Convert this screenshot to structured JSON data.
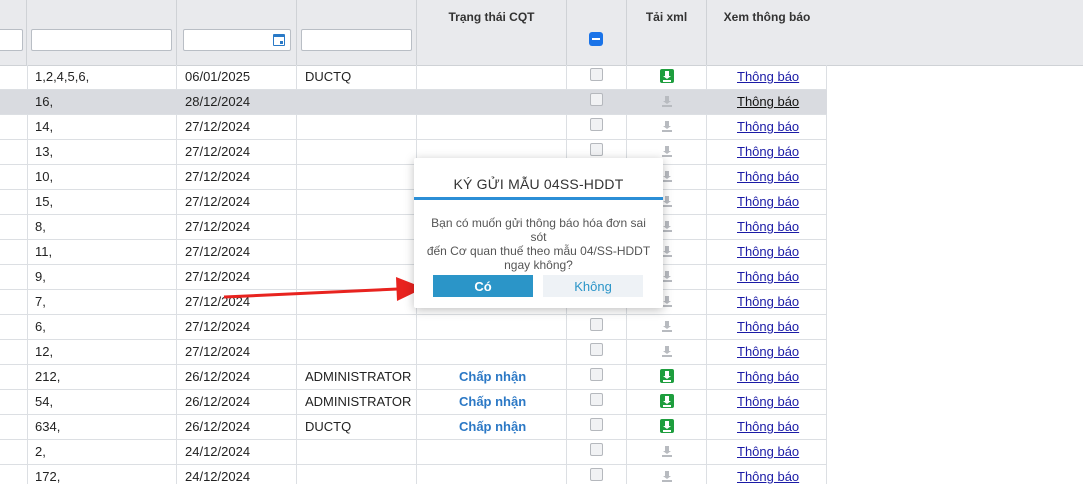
{
  "header": {
    "status_col": "Trạng thái CQT",
    "xml_col": "Tải xml",
    "notice_col": "Xem thông báo"
  },
  "rows": [
    {
      "num": "1,2,4,5,6,",
      "date": "06/01/2025",
      "user": "DUCTQ",
      "status": "",
      "xml": true,
      "link": "Thông báo"
    },
    {
      "num": "16,",
      "date": "28/12/2024",
      "user": "",
      "status": "",
      "xml": false,
      "link": "Thông báo",
      "selected": true
    },
    {
      "num": "14,",
      "date": "27/12/2024",
      "user": "",
      "status": "",
      "xml": false,
      "link": "Thông báo"
    },
    {
      "num": "13,",
      "date": "27/12/2024",
      "user": "",
      "status": "",
      "xml": false,
      "link": "Thông báo"
    },
    {
      "num": "10,",
      "date": "27/12/2024",
      "user": "",
      "status": "",
      "xml": false,
      "link": "Thông báo"
    },
    {
      "num": "15,",
      "date": "27/12/2024",
      "user": "",
      "status": "",
      "xml": false,
      "link": "Thông báo"
    },
    {
      "num": "8,",
      "date": "27/12/2024",
      "user": "",
      "status": "",
      "xml": false,
      "link": "Thông báo"
    },
    {
      "num": "11,",
      "date": "27/12/2024",
      "user": "",
      "status": "",
      "xml": false,
      "link": "Thông báo"
    },
    {
      "num": "9,",
      "date": "27/12/2024",
      "user": "",
      "status": "",
      "xml": false,
      "link": "Thông báo"
    },
    {
      "num": "7,",
      "date": "27/12/2024",
      "user": "",
      "status": "",
      "xml": false,
      "link": "Thông báo"
    },
    {
      "num": "6,",
      "date": "27/12/2024",
      "user": "",
      "status": "",
      "xml": false,
      "link": "Thông báo"
    },
    {
      "num": "12,",
      "date": "27/12/2024",
      "user": "",
      "status": "",
      "xml": false,
      "link": "Thông báo"
    },
    {
      "num": "212,",
      "date": "26/12/2024",
      "user": "ADMINISTRATOR",
      "status": "Chấp nhận",
      "xml": true,
      "link": "Thông báo"
    },
    {
      "num": "54,",
      "date": "26/12/2024",
      "user": "ADMINISTRATOR",
      "status": "Chấp nhận",
      "xml": true,
      "link": "Thông báo"
    },
    {
      "num": "634,",
      "date": "26/12/2024",
      "user": "DUCTQ",
      "status": "Chấp nhận",
      "xml": true,
      "link": "Thông báo"
    },
    {
      "num": "2,",
      "date": "24/12/2024",
      "user": "",
      "status": "",
      "xml": false,
      "link": "Thông báo"
    },
    {
      "num": "172,",
      "date": "24/12/2024",
      "user": "",
      "status": "",
      "xml": false,
      "link": "Thông báo"
    }
  ],
  "dialog": {
    "title": "KÝ GỬI MẪU 04SS-HDDT",
    "message_line1": "Bạn có muốn gửi thông báo hóa đơn sai sót",
    "message_line2": "đến Cơ quan thuế theo mẫu 04/SS-HDDT",
    "message_line3": "ngay không?",
    "yes_label": "Có",
    "no_label": "Không"
  },
  "colors": {
    "accent": "#2b95c8",
    "link": "#1a1aa6",
    "download_on": "#1e9e3e",
    "annotation_arrow": "#e8231f"
  }
}
